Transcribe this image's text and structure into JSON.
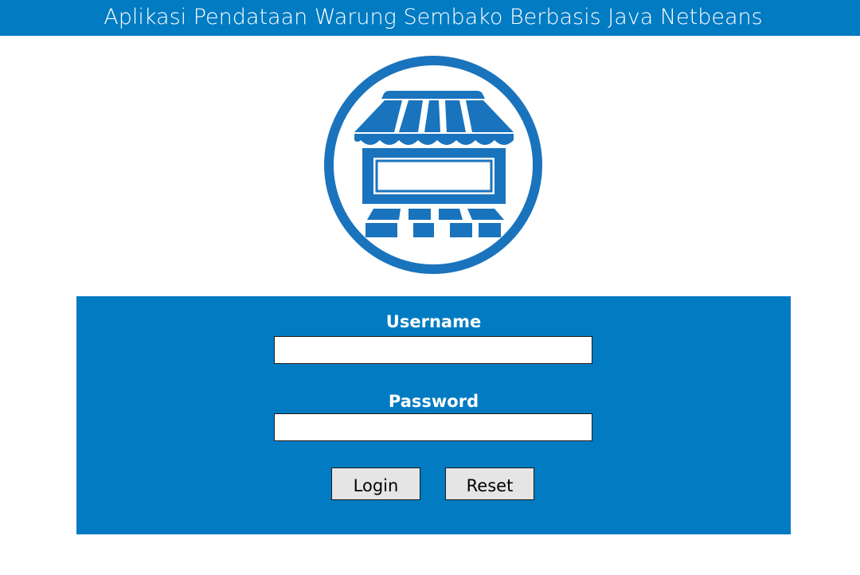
{
  "header": {
    "title": "Aplikasi Pendataan Warung Sembako Berbasis Java Netbeans"
  },
  "logo": {
    "icon": "store-awning-icon",
    "color": "#1a73bd"
  },
  "form": {
    "username_label": "Username",
    "username_value": "",
    "password_label": "Password",
    "password_value": "",
    "login_label": "Login",
    "reset_label": "Reset"
  },
  "colors": {
    "brand_blue": "#017bc2",
    "button_gray": "#e5e5e5"
  }
}
